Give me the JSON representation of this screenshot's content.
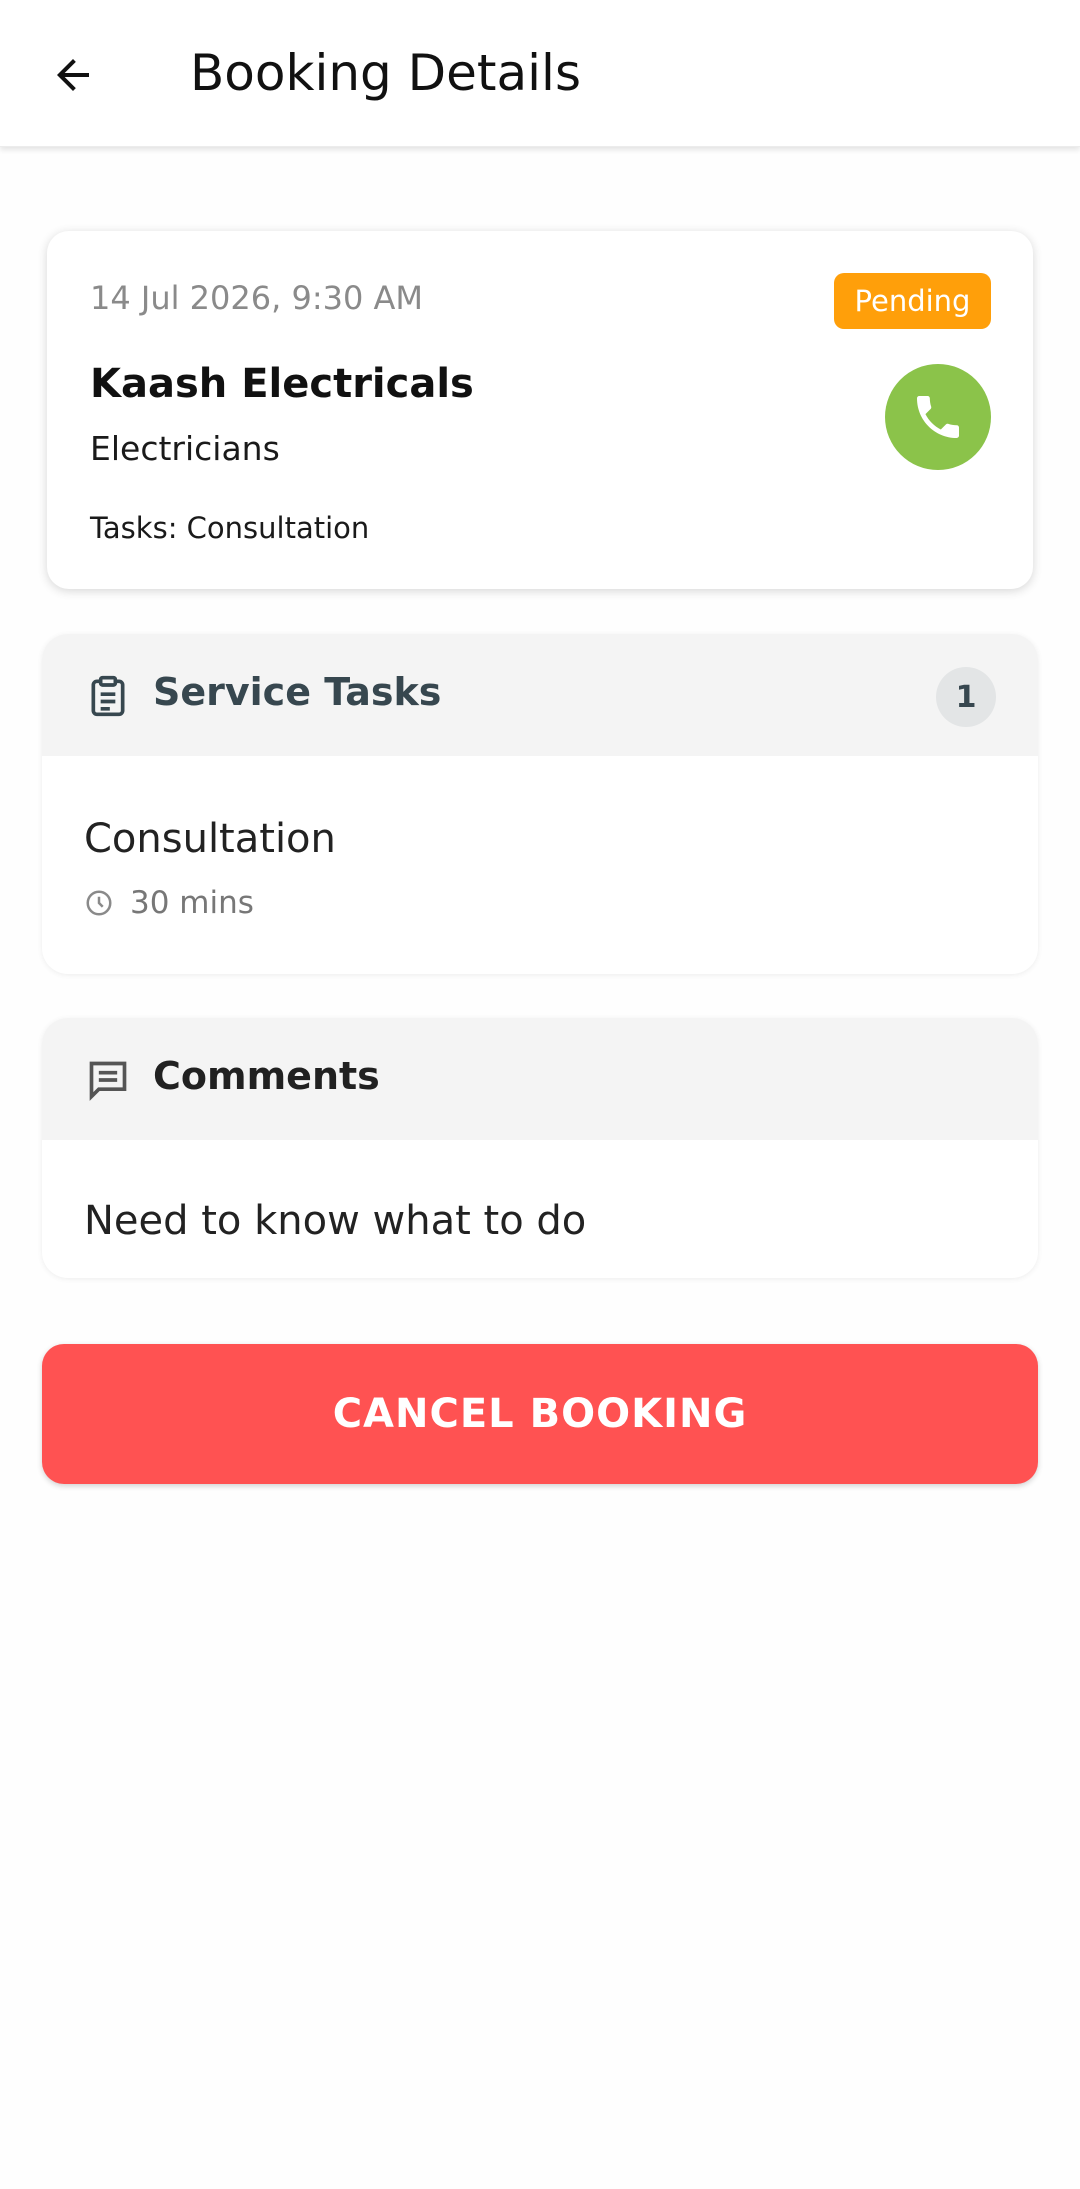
{
  "appbar": {
    "title": "Booking Details",
    "back_icon": "arrow-left-icon"
  },
  "booking": {
    "datetime": "14 Jul 2026, 9:30 AM",
    "status": "Pending",
    "provider_name": "Kaash Electricals",
    "category": "Electricians",
    "tasks_summary": "Tasks: Consultation",
    "call_icon": "phone-icon"
  },
  "service_tasks": {
    "title": "Service Tasks",
    "count": "1",
    "icon": "clipboard-icon",
    "items": [
      {
        "name": "Consultation",
        "duration": "30 mins",
        "icon": "clock-icon"
      }
    ]
  },
  "comments": {
    "title": "Comments",
    "icon": "comment-icon",
    "text": "Need to know what to do"
  },
  "actions": {
    "cancel_label": "CANCEL BOOKING"
  },
  "colors": {
    "status_pending": "#ff9f0a",
    "call_button": "#8bc34a",
    "cancel_button": "#ff5252",
    "section_header_bg": "#f4f4f4",
    "service_title": "#37474f",
    "comments_title": "#212121"
  }
}
